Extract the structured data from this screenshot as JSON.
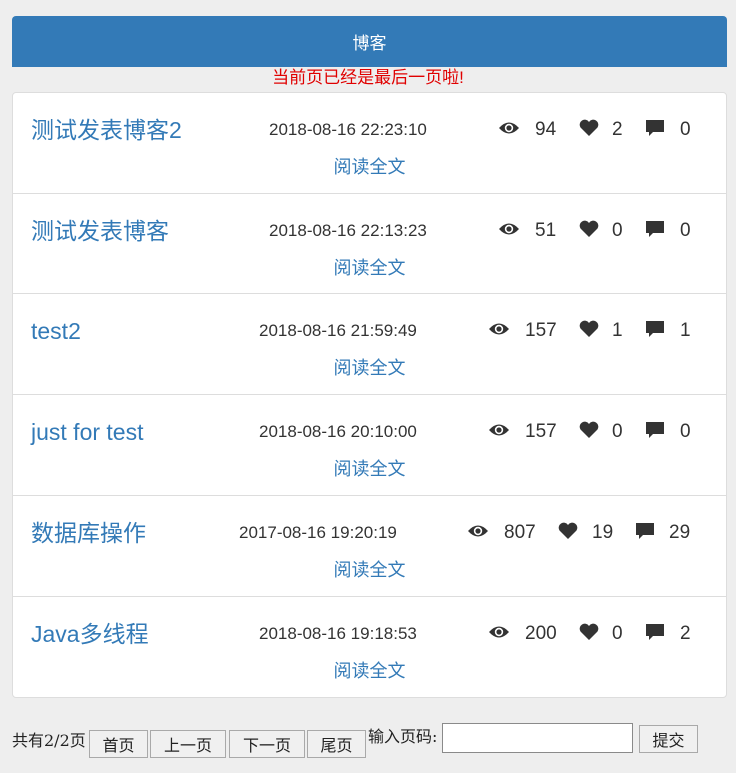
{
  "header": {
    "title": "博客"
  },
  "notice": "当前页已经是最后一页啦!",
  "posts": [
    {
      "title": "测试发表博客2",
      "date": "2018-08-16 22:23:10",
      "views": "94",
      "likes": "2",
      "comments": "0",
      "read_more": "阅读全文"
    },
    {
      "title": "测试发表博客",
      "date": "2018-08-16 22:13:23",
      "views": "51",
      "likes": "0",
      "comments": "0",
      "read_more": "阅读全文"
    },
    {
      "title": "test2",
      "date": "2018-08-16 21:59:49",
      "views": "157",
      "likes": "1",
      "comments": "1",
      "read_more": "阅读全文"
    },
    {
      "title": "just for test",
      "date": "2018-08-16 20:10:00",
      "views": "157",
      "likes": "0",
      "comments": "0",
      "read_more": "阅读全文"
    },
    {
      "title": "数据库操作",
      "date": "2017-08-16 19:20:19",
      "views": "807",
      "likes": "19",
      "comments": "29",
      "read_more": "阅读全文"
    },
    {
      "title": "Java多线程",
      "date": "2018-08-16 19:18:53",
      "views": "200",
      "likes": "0",
      "comments": "2",
      "read_more": "阅读全文"
    }
  ],
  "pagination": {
    "summary": "共有2/2页",
    "first": "首页",
    "prev": "上一页",
    "next": "下一页",
    "last": "尾页",
    "jump_label": "输入页码:",
    "jump_value": "",
    "submit": "提交"
  },
  "icons": {
    "views": "eye-icon",
    "likes": "heart-icon",
    "comments": "comment-icon"
  },
  "colors": {
    "header_bg": "#337ab7",
    "link": "#337ab7",
    "notice": "#e00000",
    "page_bg": "#eeeeee"
  }
}
